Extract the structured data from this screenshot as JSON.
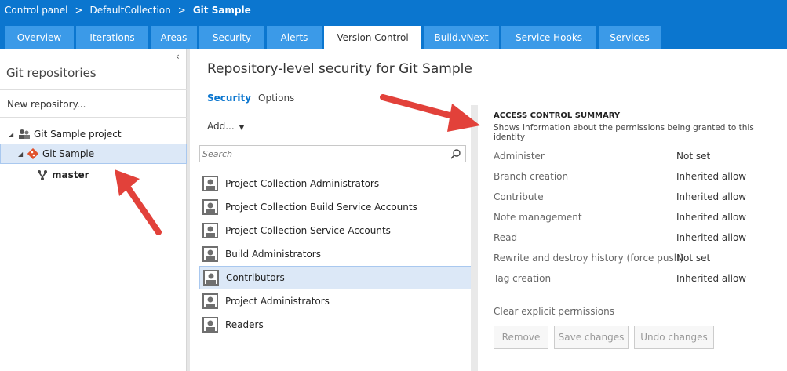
{
  "breadcrumb": {
    "items": [
      "Control panel",
      "DefaultCollection",
      "Git Sample"
    ],
    "separator": ">"
  },
  "tabs": [
    "Overview",
    "Iterations",
    "Areas",
    "Security",
    "Alerts",
    "Version Control",
    "Build.vNext",
    "Service Hooks",
    "Services"
  ],
  "active_tab": "Version Control",
  "sidebar": {
    "title": "Git repositories",
    "new_repo": "New repository...",
    "tree": {
      "project": "Git Sample project",
      "repo": "Git Sample",
      "branch": "master"
    }
  },
  "main": {
    "title": "Repository-level security for Git Sample",
    "subtabs": [
      "Security",
      "Options"
    ],
    "add_label": "Add...",
    "search_placeholder": "Search",
    "groups": [
      "Project Collection Administrators",
      "Project Collection Build Service Accounts",
      "Project Collection Service Accounts",
      "Build Administrators",
      "Contributors",
      "Project Administrators",
      "Readers"
    ],
    "selected_group": "Contributors"
  },
  "acs": {
    "title": "ACCESS CONTROL SUMMARY",
    "subtitle": "Shows information about the permissions being granted to this identity",
    "permissions": [
      {
        "name": "Administer",
        "value": "Not set"
      },
      {
        "name": "Branch creation",
        "value": "Inherited allow"
      },
      {
        "name": "Contribute",
        "value": "Inherited allow"
      },
      {
        "name": "Note management",
        "value": "Inherited allow"
      },
      {
        "name": "Read",
        "value": "Inherited allow"
      },
      {
        "name": "Rewrite and destroy history (force push)",
        "value": "Not set"
      },
      {
        "name": "Tag creation",
        "value": "Inherited allow"
      }
    ],
    "clear_label": "Clear explicit permissions",
    "buttons": {
      "remove": "Remove",
      "save": "Save changes",
      "undo": "Undo changes"
    }
  },
  "colors": {
    "header": "#0b76cf",
    "tab": "#3b9ae8",
    "accent": "#0b76cf",
    "selection": "#dce8f7",
    "arrow": "#e2413a"
  }
}
